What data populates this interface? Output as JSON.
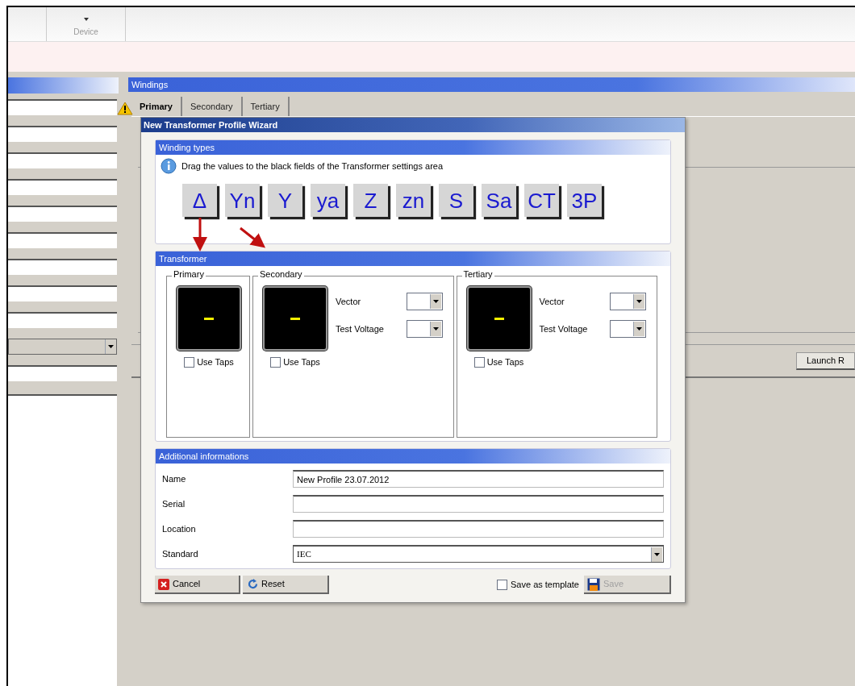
{
  "ribbon": {
    "group_label": "Device"
  },
  "windings": {
    "title": "Windings",
    "tabs": [
      {
        "label": "Primary",
        "selected": true
      },
      {
        "label": "Secondary",
        "selected": false
      },
      {
        "label": "Tertiary",
        "selected": false
      }
    ]
  },
  "launch_button": "Launch R",
  "dialog": {
    "title": "New Transformer Profile Wizard",
    "winding_types": {
      "title": "Winding types",
      "hint": "Drag the values to the black fields of the Transformer settings area",
      "symbols": [
        "Δ",
        "Yn",
        "Y",
        "ya",
        "Z",
        "zn",
        "S",
        "Sa",
        "CT",
        "3P"
      ]
    },
    "transformer": {
      "title": "Transformer",
      "windings": [
        {
          "label": "Primary",
          "use_taps": false,
          "use_taps_label": "Use Taps",
          "kind": "plain"
        },
        {
          "label": "Secondary",
          "use_taps": false,
          "use_taps_label": "Use Taps",
          "kind": "vector",
          "vector_label": "Vector",
          "test_voltage_label": "Test Voltage"
        },
        {
          "label": "Tertiary",
          "use_taps": false,
          "use_taps_label": "Use Taps",
          "kind": "vector",
          "vector_label": "Vector",
          "test_voltage_label": "Test Voltage"
        }
      ]
    },
    "additional": {
      "title": "Additional informations",
      "fields": [
        {
          "label": "Name",
          "value": "New Profile 23.07.2012",
          "kind": "text"
        },
        {
          "label": "Serial",
          "kind": "text"
        },
        {
          "label": "Location",
          "kind": "text"
        },
        {
          "label": "Standard",
          "value": "IEC",
          "kind": "select"
        }
      ]
    },
    "cancel_button": "Cancel",
    "reset_button": "Reset",
    "save_template": {
      "label": "Save as template",
      "checked": false
    },
    "save_button": {
      "label": "Save",
      "disabled": true
    }
  }
}
